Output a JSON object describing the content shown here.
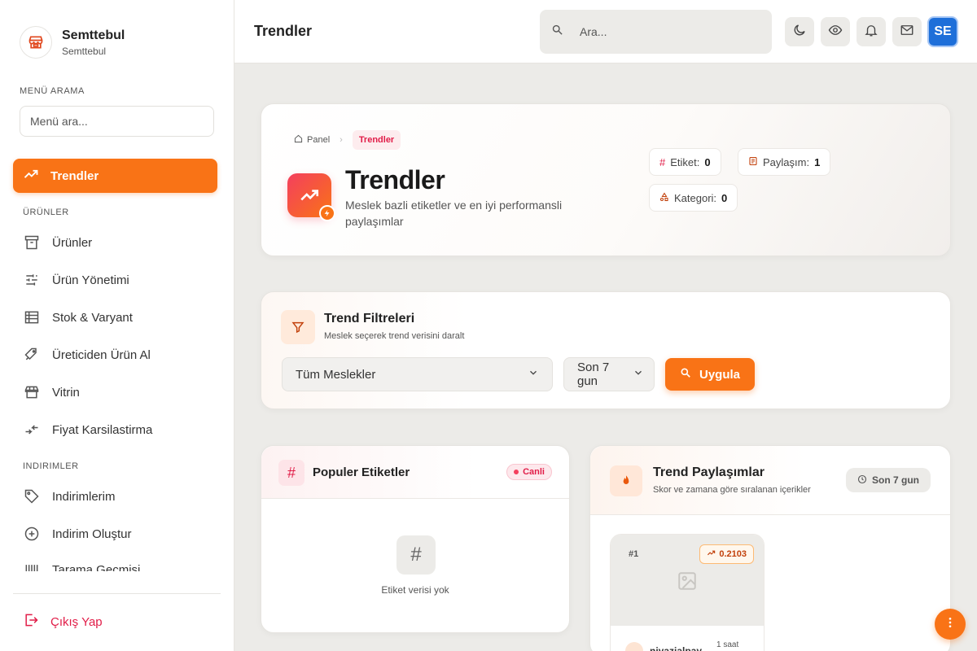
{
  "brand": {
    "title": "Semttebul",
    "subtitle": "Semttebul"
  },
  "sidebar": {
    "search_label": "MENÜ ARAMA",
    "search_placeholder": "Menü ara...",
    "active_item": {
      "label": "Trendler",
      "icon": "trending-up-icon"
    },
    "groups": [
      {
        "label": "ÜRÜNLER",
        "items": [
          {
            "label": "Ürünler",
            "icon": "archive-icon"
          },
          {
            "label": "Ürün Yönetimi",
            "icon": "sliders-icon"
          },
          {
            "label": "Stok & Varyant",
            "icon": "table-icon"
          },
          {
            "label": "Üreticiden Ürün Al",
            "icon": "tags-icon"
          },
          {
            "label": "Vitrin",
            "icon": "store-icon"
          },
          {
            "label": "Fiyat Karsilastirma",
            "icon": "compare-icon"
          }
        ]
      },
      {
        "label": "INDIRIMLER",
        "items": [
          {
            "label": "Indirimlerim",
            "icon": "tag-icon"
          },
          {
            "label": "Indirim Oluştur",
            "icon": "plus-circle-icon"
          },
          {
            "label": "Tarama Geçmişi",
            "icon": "barcode-icon"
          }
        ]
      }
    ],
    "logout_label": "Çıkış Yap"
  },
  "topbar": {
    "title": "Trendler",
    "search_placeholder": "Ara...",
    "avatar_initials": "SE"
  },
  "hero": {
    "breadcrumb_home": "Panel",
    "breadcrumb_current": "Trendler",
    "title": "Trendler",
    "description": "Meslek bazli etiketler ve en iyi performansli paylaşımlar",
    "stats": [
      {
        "label": "Etiket:",
        "value": "0"
      },
      {
        "label": "Paylaşım:",
        "value": "1"
      },
      {
        "label": "Kategori:",
        "value": "0"
      }
    ]
  },
  "filters": {
    "title": "Trend Filtreleri",
    "subtitle": "Meslek seçerek trend verisini daralt",
    "profession_select": "Tüm Meslekler",
    "period_select": "Son 7 gun",
    "apply_label": "Uygula"
  },
  "tags_card": {
    "title": "Populer Etiketler",
    "live_label": "Canli",
    "empty_icon": "#",
    "empty_text": "Etiket verisi yok"
  },
  "posts_card": {
    "title": "Trend Paylaşımlar",
    "subtitle": "Skor ve zamana göre sıralanan içerikler",
    "period_label": "Son 7 gun",
    "posts": [
      {
        "rank": "#1",
        "score": "0.2103",
        "user": "niyazialpay",
        "time": "1 saat"
      }
    ]
  },
  "colors": {
    "accent": "#f97316",
    "danger": "#e11d48",
    "avatar": "#1e6fd9"
  }
}
